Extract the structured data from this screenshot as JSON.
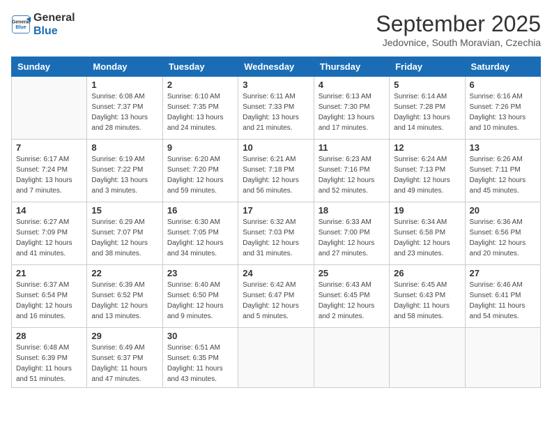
{
  "logo": {
    "line1": "General",
    "line2": "Blue"
  },
  "title": "September 2025",
  "location": "Jedovnice, South Moravian, Czechia",
  "days_of_week": [
    "Sunday",
    "Monday",
    "Tuesday",
    "Wednesday",
    "Thursday",
    "Friday",
    "Saturday"
  ],
  "weeks": [
    [
      {
        "day": "",
        "info": ""
      },
      {
        "day": "1",
        "info": "Sunrise: 6:08 AM\nSunset: 7:37 PM\nDaylight: 13 hours\nand 28 minutes."
      },
      {
        "day": "2",
        "info": "Sunrise: 6:10 AM\nSunset: 7:35 PM\nDaylight: 13 hours\nand 24 minutes."
      },
      {
        "day": "3",
        "info": "Sunrise: 6:11 AM\nSunset: 7:33 PM\nDaylight: 13 hours\nand 21 minutes."
      },
      {
        "day": "4",
        "info": "Sunrise: 6:13 AM\nSunset: 7:30 PM\nDaylight: 13 hours\nand 17 minutes."
      },
      {
        "day": "5",
        "info": "Sunrise: 6:14 AM\nSunset: 7:28 PM\nDaylight: 13 hours\nand 14 minutes."
      },
      {
        "day": "6",
        "info": "Sunrise: 6:16 AM\nSunset: 7:26 PM\nDaylight: 13 hours\nand 10 minutes."
      }
    ],
    [
      {
        "day": "7",
        "info": "Sunrise: 6:17 AM\nSunset: 7:24 PM\nDaylight: 13 hours\nand 7 minutes."
      },
      {
        "day": "8",
        "info": "Sunrise: 6:19 AM\nSunset: 7:22 PM\nDaylight: 13 hours\nand 3 minutes."
      },
      {
        "day": "9",
        "info": "Sunrise: 6:20 AM\nSunset: 7:20 PM\nDaylight: 12 hours\nand 59 minutes."
      },
      {
        "day": "10",
        "info": "Sunrise: 6:21 AM\nSunset: 7:18 PM\nDaylight: 12 hours\nand 56 minutes."
      },
      {
        "day": "11",
        "info": "Sunrise: 6:23 AM\nSunset: 7:16 PM\nDaylight: 12 hours\nand 52 minutes."
      },
      {
        "day": "12",
        "info": "Sunrise: 6:24 AM\nSunset: 7:13 PM\nDaylight: 12 hours\nand 49 minutes."
      },
      {
        "day": "13",
        "info": "Sunrise: 6:26 AM\nSunset: 7:11 PM\nDaylight: 12 hours\nand 45 minutes."
      }
    ],
    [
      {
        "day": "14",
        "info": "Sunrise: 6:27 AM\nSunset: 7:09 PM\nDaylight: 12 hours\nand 41 minutes."
      },
      {
        "day": "15",
        "info": "Sunrise: 6:29 AM\nSunset: 7:07 PM\nDaylight: 12 hours\nand 38 minutes."
      },
      {
        "day": "16",
        "info": "Sunrise: 6:30 AM\nSunset: 7:05 PM\nDaylight: 12 hours\nand 34 minutes."
      },
      {
        "day": "17",
        "info": "Sunrise: 6:32 AM\nSunset: 7:03 PM\nDaylight: 12 hours\nand 31 minutes."
      },
      {
        "day": "18",
        "info": "Sunrise: 6:33 AM\nSunset: 7:00 PM\nDaylight: 12 hours\nand 27 minutes."
      },
      {
        "day": "19",
        "info": "Sunrise: 6:34 AM\nSunset: 6:58 PM\nDaylight: 12 hours\nand 23 minutes."
      },
      {
        "day": "20",
        "info": "Sunrise: 6:36 AM\nSunset: 6:56 PM\nDaylight: 12 hours\nand 20 minutes."
      }
    ],
    [
      {
        "day": "21",
        "info": "Sunrise: 6:37 AM\nSunset: 6:54 PM\nDaylight: 12 hours\nand 16 minutes."
      },
      {
        "day": "22",
        "info": "Sunrise: 6:39 AM\nSunset: 6:52 PM\nDaylight: 12 hours\nand 13 minutes."
      },
      {
        "day": "23",
        "info": "Sunrise: 6:40 AM\nSunset: 6:50 PM\nDaylight: 12 hours\nand 9 minutes."
      },
      {
        "day": "24",
        "info": "Sunrise: 6:42 AM\nSunset: 6:47 PM\nDaylight: 12 hours\nand 5 minutes."
      },
      {
        "day": "25",
        "info": "Sunrise: 6:43 AM\nSunset: 6:45 PM\nDaylight: 12 hours\nand 2 minutes."
      },
      {
        "day": "26",
        "info": "Sunrise: 6:45 AM\nSunset: 6:43 PM\nDaylight: 11 hours\nand 58 minutes."
      },
      {
        "day": "27",
        "info": "Sunrise: 6:46 AM\nSunset: 6:41 PM\nDaylight: 11 hours\nand 54 minutes."
      }
    ],
    [
      {
        "day": "28",
        "info": "Sunrise: 6:48 AM\nSunset: 6:39 PM\nDaylight: 11 hours\nand 51 minutes."
      },
      {
        "day": "29",
        "info": "Sunrise: 6:49 AM\nSunset: 6:37 PM\nDaylight: 11 hours\nand 47 minutes."
      },
      {
        "day": "30",
        "info": "Sunrise: 6:51 AM\nSunset: 6:35 PM\nDaylight: 11 hours\nand 43 minutes."
      },
      {
        "day": "",
        "info": ""
      },
      {
        "day": "",
        "info": ""
      },
      {
        "day": "",
        "info": ""
      },
      {
        "day": "",
        "info": ""
      }
    ]
  ]
}
